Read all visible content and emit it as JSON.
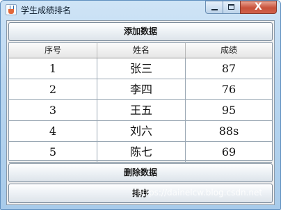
{
  "window": {
    "title": "学生成绩排名",
    "icon": "java-cup-icon",
    "controls": {
      "minimize": "minimize-icon",
      "maximize": "maximize-icon",
      "close": "X"
    }
  },
  "buttons": {
    "add": "添加数据",
    "delete": "删除数据",
    "sort": "排序"
  },
  "table": {
    "columns": [
      "序号",
      "姓名",
      "成绩"
    ],
    "rows": [
      [
        "1",
        "张三",
        "87"
      ],
      [
        "2",
        "李四",
        "76"
      ],
      [
        "3",
        "王五",
        "95"
      ],
      [
        "4",
        "刘六",
        "88s"
      ],
      [
        "5",
        "陈七",
        "69"
      ]
    ]
  },
  "watermark": "https://dainelcw.blog.csdn.net"
}
